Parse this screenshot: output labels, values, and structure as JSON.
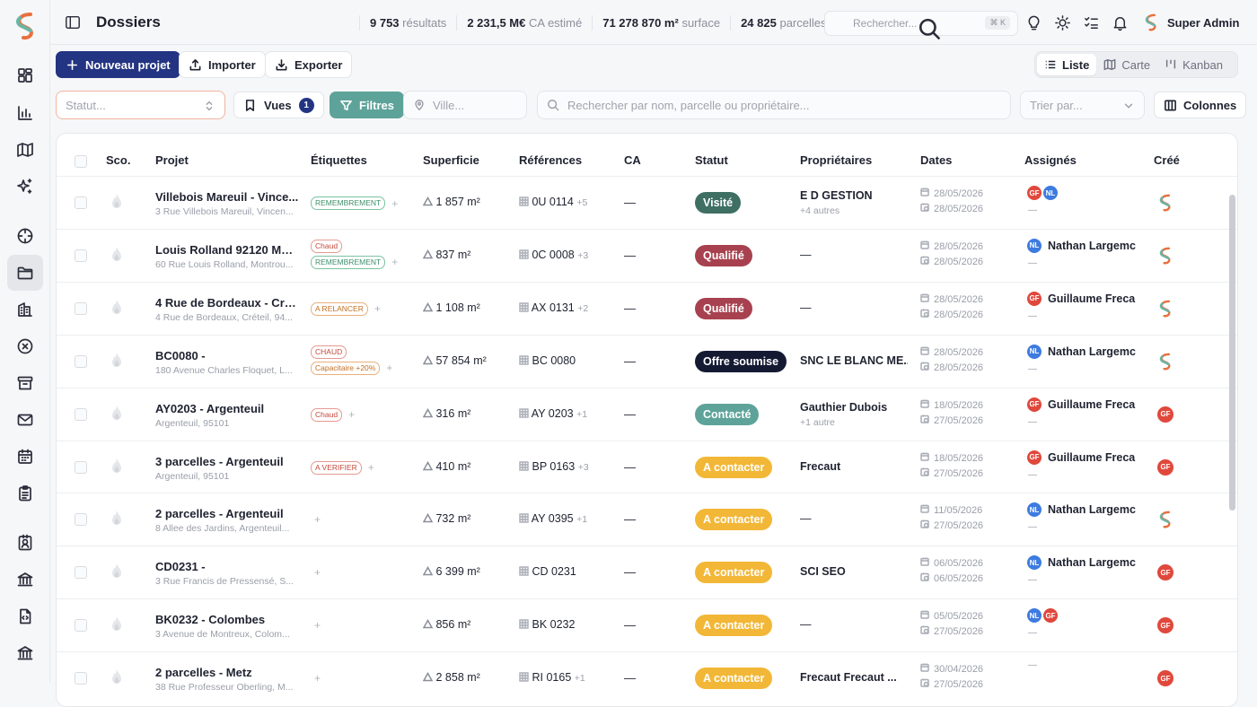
{
  "header": {
    "title": "Dossiers",
    "stats": [
      {
        "value": "9 753",
        "label": "résultats"
      },
      {
        "value": "2 231,5 M€",
        "label": "CA estimé"
      },
      {
        "value": "71 278 870 m²",
        "label": "surface"
      },
      {
        "value": "24 825",
        "label": "parcelles"
      }
    ],
    "search_placeholder": "Rechercher...",
    "search_kbd": "⌘ K",
    "user_name": "Super Admin"
  },
  "sidebar": {
    "items": [
      {
        "icon": "grid-icon"
      },
      {
        "icon": "bar-chart-icon"
      },
      {
        "icon": "map-icon"
      },
      {
        "icon": "sparkles-icon"
      },
      {
        "icon": "crosshair-icon"
      },
      {
        "icon": "folder-icon",
        "active": true
      },
      {
        "icon": "building-icon"
      },
      {
        "icon": "x-circle-icon"
      },
      {
        "icon": "archive-icon"
      },
      {
        "icon": "mail-icon"
      },
      {
        "icon": "calendar-icon"
      },
      {
        "icon": "clipboard-icon"
      },
      {
        "icon": "contact-icon"
      },
      {
        "icon": "bank-icon"
      },
      {
        "icon": "file-code-icon"
      },
      {
        "icon": "bank-alt-icon"
      }
    ]
  },
  "toolbar": {
    "new_project": "Nouveau projet",
    "import": "Importer",
    "export": "Exporter",
    "views": [
      "Liste",
      "Carte",
      "Kanban"
    ],
    "active_view": "Liste"
  },
  "filters": {
    "status_placeholder": "Statut...",
    "vues_label": "Vues",
    "vues_count": "1",
    "filtres_label": "Filtres",
    "ville_placeholder": "Ville...",
    "search_placeholder": "Rechercher par nom, parcelle ou propriétaire...",
    "sort_placeholder": "Trier par...",
    "columns_label": "Colonnes"
  },
  "table": {
    "columns": [
      "Sco.",
      "Projet",
      "Étiquettes",
      "Superficie",
      "Références",
      "CA",
      "Statut",
      "Propriétaires",
      "Dates",
      "Assignés",
      "Créé"
    ],
    "status_colors": {
      "Visité": "#3f6f63",
      "Qualifié": "#a8414f",
      "Offre soumise": "#151a33",
      "Contacté": "#5ea39a",
      "A contacter": "#f2b736"
    },
    "rows": [
      {
        "name": "Villebois Mareuil - Vince...",
        "addr": "3 Rue Villebois Mareuil, Vincen...",
        "tags": [
          {
            "t": "REMEMBREMENT",
            "c": "g"
          }
        ],
        "sup": "1 857 m²",
        "ref": "0U 0114",
        "refx": "+5",
        "ca": "—",
        "status": "Visité",
        "owner": "E D GESTION",
        "owner2": "+4 autres",
        "d1": "28/05/2026",
        "d2": "28/05/2026",
        "assign": [
          "GF",
          "NL"
        ],
        "assign_name": "",
        "created": "logo"
      },
      {
        "name": "Louis Rolland 92120 Mont...",
        "addr": "60 Rue Louis Rolland, Montrou...",
        "tags": [
          {
            "t": "Chaud",
            "c": "r"
          },
          {
            "t": "REMEMBREMENT",
            "c": "g"
          }
        ],
        "sup": "837 m²",
        "ref": "0C 0008",
        "refx": "+3",
        "ca": "—",
        "status": "Qualifié",
        "owner": "—",
        "owner2": "",
        "d1": "28/05/2026",
        "d2": "28/05/2026",
        "assign": [
          "NL"
        ],
        "assign_name": "Nathan Largemc",
        "created": "logo"
      },
      {
        "name": "4 Rue de Bordeaux - Crét...",
        "addr": "4 Rue de Bordeaux, Créteil, 94...",
        "tags": [
          {
            "t": "A RELANCER",
            "c": "o"
          }
        ],
        "sup": "1 108 m²",
        "ref": "AX 0131",
        "refx": "+2",
        "ca": "—",
        "status": "Qualifié",
        "owner": "—",
        "owner2": "",
        "d1": "28/05/2026",
        "d2": "28/05/2026",
        "assign": [
          "GF"
        ],
        "assign_name": "Guillaume Freca",
        "created": "logo"
      },
      {
        "name": "BC0080 -",
        "addr": "180 Avenue Charles Floquet, L...",
        "tags": [
          {
            "t": "CHAUD",
            "c": "r"
          },
          {
            "t": "Capacitaire +20%",
            "c": "o"
          }
        ],
        "sup": "57 854 m²",
        "ref": "BC 0080",
        "refx": "",
        "ca": "—",
        "status": "Offre soumise",
        "owner": "SNC LE BLANC ME...",
        "owner2": "",
        "d1": "28/05/2026",
        "d2": "28/05/2026",
        "assign": [
          "NL"
        ],
        "assign_name": "Nathan Largemc",
        "created": "logo"
      },
      {
        "name": "AY0203 - Argenteuil",
        "addr": "Argenteuil, 95101",
        "tags": [
          {
            "t": "Chaud",
            "c": "r"
          }
        ],
        "sup": "316 m²",
        "ref": "AY 0203",
        "refx": "+1",
        "ca": "—",
        "status": "Contacté",
        "owner": "Gauthier Dubois",
        "owner2": "+1 autre",
        "d1": "18/05/2026",
        "d2": "27/05/2026",
        "assign": [
          "GF"
        ],
        "assign_name": "Guillaume Freca",
        "created": "GF"
      },
      {
        "name": "3 parcelles - Argenteuil",
        "addr": "Argenteuil, 95101",
        "tags": [
          {
            "t": "A VERIFIER",
            "c": "r"
          }
        ],
        "sup": "410 m²",
        "ref": "BP 0163",
        "refx": "+3",
        "ca": "—",
        "status": "A contacter",
        "owner": "Frecaut",
        "owner2": "",
        "d1": "18/05/2026",
        "d2": "27/05/2026",
        "assign": [
          "GF"
        ],
        "assign_name": "Guillaume Freca",
        "created": "GF"
      },
      {
        "name": "2 parcelles - Argenteuil",
        "addr": "8 Allee des Jardins, Argenteuil...",
        "tags": [],
        "sup": "732 m²",
        "ref": "AY 0395",
        "refx": "+1",
        "ca": "—",
        "status": "A contacter",
        "owner": "—",
        "owner2": "",
        "d1": "11/05/2026",
        "d2": "27/05/2026",
        "assign": [
          "NL"
        ],
        "assign_name": "Nathan Largemc",
        "created": "logo"
      },
      {
        "name": "CD0231 -",
        "addr": "3 Rue Francis de Pressensé, S...",
        "tags": [],
        "sup": "6 399 m²",
        "ref": "CD 0231",
        "refx": "",
        "ca": "—",
        "status": "A contacter",
        "owner": "SCI SEO",
        "owner2": "",
        "d1": "06/05/2026",
        "d2": "06/05/2026",
        "assign": [
          "NL"
        ],
        "assign_name": "Nathan Largemc",
        "created": "GF"
      },
      {
        "name": "BK0232 - Colombes",
        "addr": "3 Avenue de Montreux, Colom...",
        "tags": [],
        "sup": "856 m²",
        "ref": "BK 0232",
        "refx": "",
        "ca": "—",
        "status": "A contacter",
        "owner": "—",
        "owner2": "",
        "d1": "05/05/2026",
        "d2": "27/05/2026",
        "assign": [
          "NL",
          "GF"
        ],
        "assign_name": "",
        "created": "GF"
      },
      {
        "name": "2 parcelles - Metz",
        "addr": "38 Rue Professeur Oberling, M...",
        "tags": [],
        "sup": "2 858 m²",
        "ref": "RI 0165",
        "refx": "+1",
        "ca": "—",
        "status": "A contacter",
        "owner": "Frecaut Frecaut ...",
        "owner2": "",
        "d1": "30/04/2026",
        "d2": "27/05/2026",
        "assign": [],
        "assign_name": "",
        "created": "GF"
      }
    ]
  }
}
